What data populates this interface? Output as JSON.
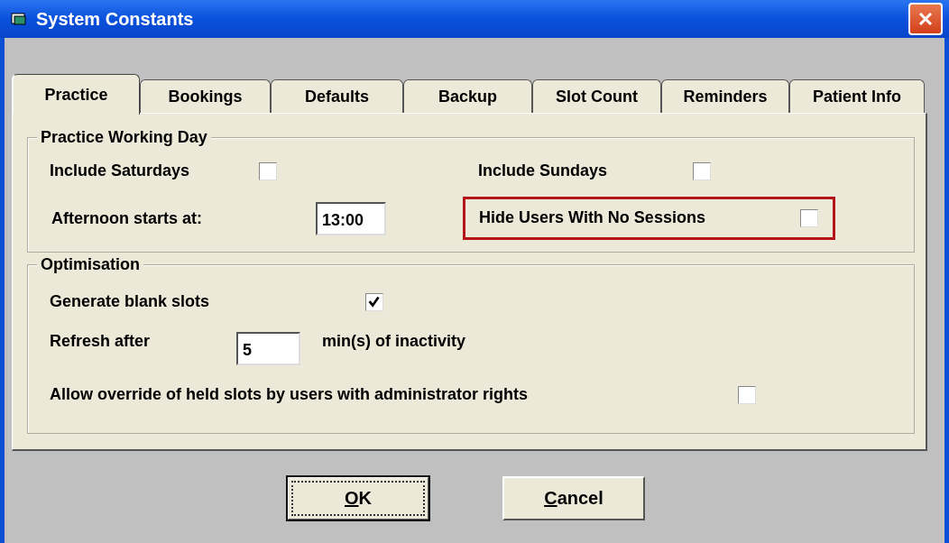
{
  "window": {
    "title": "System Constants"
  },
  "tabs": [
    {
      "label": "Practice",
      "selected": true
    },
    {
      "label": "Bookings",
      "selected": false
    },
    {
      "label": "Defaults",
      "selected": false
    },
    {
      "label": "Backup",
      "selected": false
    },
    {
      "label": "Slot Count",
      "selected": false
    },
    {
      "label": "Reminders",
      "selected": false
    },
    {
      "label": "Patient Info",
      "selected": false
    }
  ],
  "working_day": {
    "title": "Practice Working Day",
    "include_saturdays": {
      "label": "Include Saturdays",
      "checked": false
    },
    "include_sundays": {
      "label": "Include Sundays",
      "checked": false
    },
    "afternoon_start": {
      "label": "Afternoon starts at:",
      "value": "13:00"
    },
    "hide_users": {
      "label": "Hide Users With No Sessions",
      "checked": false,
      "highlighted": true
    }
  },
  "optimisation": {
    "title": "Optimisation",
    "generate_blank_slots": {
      "label": "Generate blank slots",
      "checked": true
    },
    "refresh": {
      "label": "Refresh after",
      "value": "5",
      "suffix": "min(s) of inactivity"
    },
    "allow_override": {
      "label": "Allow override of held slots by users with administrator rights",
      "checked": false
    }
  },
  "buttons": [
    {
      "mnemonic": "O",
      "rest": "K",
      "default": true
    },
    {
      "mnemonic": "C",
      "rest": "ancel",
      "default": false
    }
  ]
}
